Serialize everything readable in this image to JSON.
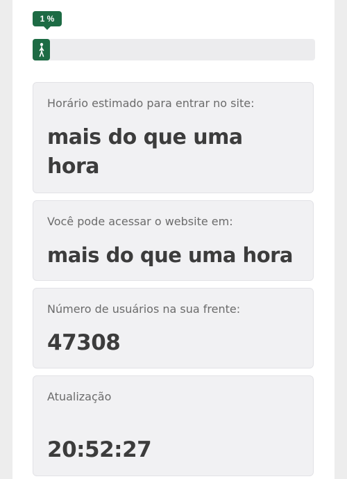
{
  "progress": {
    "label": "1 %",
    "value": 0.01,
    "icon": "walking-person-icon",
    "color": "#1d6b44"
  },
  "cards": [
    {
      "label": "Horário estimado para entrar no site:",
      "value": "mais do que uma hora"
    },
    {
      "label": "Você pode acessar o website em:",
      "value": "mais do que uma hora"
    },
    {
      "label": "Número de usuários na sua frente:",
      "value": "47308"
    },
    {
      "label": "Atualização",
      "value": "20:52:27"
    }
  ]
}
